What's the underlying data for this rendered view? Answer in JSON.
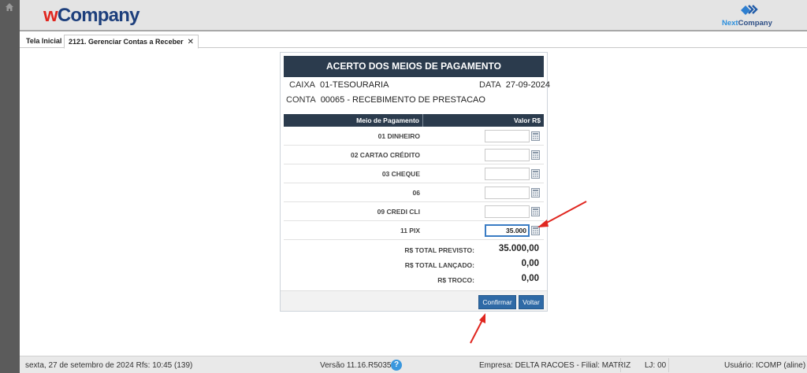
{
  "app": {
    "logo_w": "w",
    "logo_rest": "Company",
    "brand_right_prefix": "Next",
    "brand_right_rest": "Company"
  },
  "tabs": [
    {
      "label": "Tela Inicial"
    },
    {
      "label": "2121. Gerenciar Contas a Receber",
      "close": "✕"
    }
  ],
  "panel": {
    "title": "ACERTO DOS MEIOS DE PAGAMENTO",
    "caixa_label": "CAIXA",
    "caixa_value": "01-TESOURARIA",
    "data_label": "DATA",
    "data_value": "27-09-2024",
    "conta_label": "CONTA",
    "conta_value": "00065 - RECEBIMENTO DE PRESTACAO",
    "col_meio": "Meio de Pagamento",
    "col_valor": "Valor R$",
    "rows": [
      {
        "name": "01 DINHEIRO",
        "value": ""
      },
      {
        "name": "02 CARTAO CRÉDITO",
        "value": ""
      },
      {
        "name": "03 CHEQUE",
        "value": ""
      },
      {
        "name": "06",
        "value": ""
      },
      {
        "name": "09 CREDI CLI",
        "value": ""
      },
      {
        "name": "11 PIX",
        "value": "35.000"
      }
    ],
    "totals": {
      "previsto_label": "R$ TOTAL PREVISTO:",
      "previsto_value": "35.000,00",
      "lancado_label": "R$ TOTAL LANÇADO:",
      "lancado_value": "0,00",
      "troco_label": "R$ TROCO:",
      "troco_value": "0,00"
    },
    "confirm_label": "Confirmar",
    "back_label": "Voltar"
  },
  "status": {
    "date": "sexta, 27 de setembro de 2024  Rfs: 10:45 (139)",
    "version": "Versão 11.16.R5035",
    "help": "?",
    "empresa": "Empresa: DELTA RACOES - Filial: MATRIZ",
    "lj": "LJ: 00",
    "user": "Usuário: ICOMP (aline)"
  },
  "colors": {
    "header": "#2b3b4d",
    "button": "#2f6aa6",
    "arrow": "#e0261f",
    "logo_red": "#e0261f",
    "logo_blue": "#1d3f7c"
  },
  "icons": [
    "home-icon",
    "nextcompany-logo-icon",
    "calculator-icon",
    "help-icon",
    "annotation-arrow"
  ]
}
